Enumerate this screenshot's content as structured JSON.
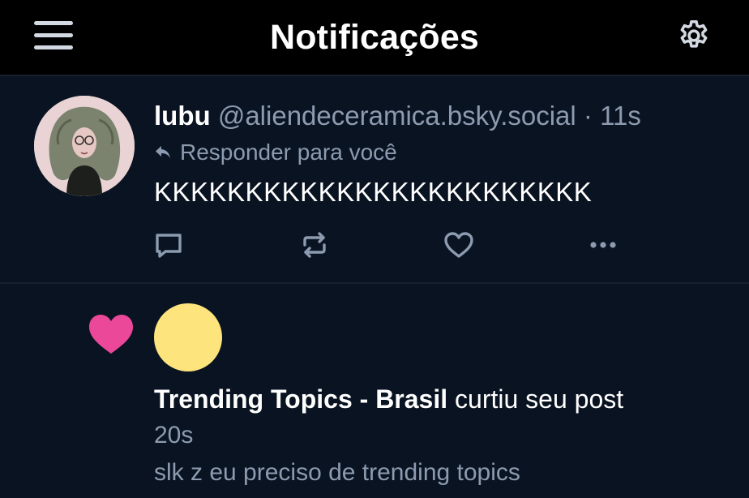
{
  "header": {
    "title": "Notificações",
    "menu_icon": "hamburger-menu-icon",
    "settings_icon": "gear-icon"
  },
  "post": {
    "author_name": "lubu",
    "author_handle": "@aliendeceramica.bsky.social",
    "separator": "·",
    "time": "11s",
    "reply_label": "Responder para você",
    "text": "KKKKKKKKKKKKKKKKKKKKKKKK",
    "actions": [
      "reply-icon",
      "repost-icon",
      "like-icon",
      "more-icon"
    ]
  },
  "notification": {
    "badge_icon": "heart-icon",
    "actor_name": "Trending Topics - Brasil",
    "action_text": "curtiu seu post",
    "time": "20s",
    "post_preview": "slk z eu preciso de trending topics"
  },
  "colors": {
    "header_bg": "#000000",
    "content_bg": "#0a1321",
    "muted_text": "#8c9bb0",
    "like_pink": "#ec4899",
    "avatar_yellow": "#fde47d"
  }
}
